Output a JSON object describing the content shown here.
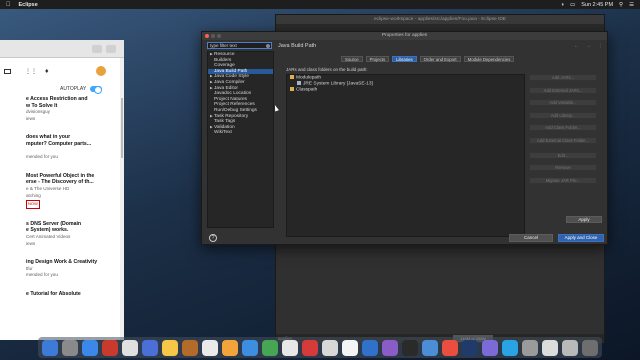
{
  "menubar": {
    "app_name": "Eclipse",
    "clock": "Sun 2:45 PM"
  },
  "browser": {
    "autoplay": "AUTOPLAY",
    "videos": [
      {
        "title": "e Access Restriction and\nw To Solve It",
        "meta": "dvisionsguy\niews"
      },
      {
        "title": "does what in your\nmputer? Computer parts...",
        "meta": "\nmended for you"
      },
      {
        "title": "Most Powerful Object in the\nerse - The Discovery of th...",
        "meta": "e & The Universe HD\natching",
        "tag": "NOW"
      },
      {
        "title": "s DNS Server (Domain\ne System) works.",
        "meta": "Cert Animated Videos\niews"
      },
      {
        "title": "ing Design Work & Creativity",
        "meta": "tfur\nmended for you"
      },
      {
        "title": "e Tutorial for Absolute",
        "meta": ""
      }
    ]
  },
  "eclipse": {
    "title": "eclipse-workspace - applies/src/applies/Foo.java - Eclipse IDE",
    "status": "applies",
    "heap": "140M of 258M"
  },
  "dialog": {
    "title": "Properties for applies",
    "filter_placeholder": "type filter text",
    "page_title": "Java Build Path",
    "tree": [
      {
        "label": "Resource",
        "expand": true
      },
      {
        "label": "Builders"
      },
      {
        "label": "Coverage"
      },
      {
        "label": "Java Build Path",
        "selected": true
      },
      {
        "label": "Java Code Style",
        "expand": true
      },
      {
        "label": "Java Compiler",
        "expand": true
      },
      {
        "label": "Java Editor",
        "expand": true
      },
      {
        "label": "Javadoc Location"
      },
      {
        "label": "Project Natures"
      },
      {
        "label": "Project References"
      },
      {
        "label": "Run/Debug Settings"
      },
      {
        "label": "Task Repository",
        "expand": true
      },
      {
        "label": "Task Tags"
      },
      {
        "label": "Validation",
        "expand": true
      },
      {
        "label": "WikiText"
      }
    ],
    "tabs": [
      "Source",
      "Projects",
      "Libraries",
      "Order and Export",
      "Module Dependencies"
    ],
    "active_tab": "Libraries",
    "jars_label": "JARs and class folders on the build path:",
    "libraries": [
      {
        "label": "Modulepath",
        "level": 1
      },
      {
        "label": "JRE System Library [JavaSE-13]",
        "level": 2
      },
      {
        "label": "Classpath",
        "level": 1
      }
    ],
    "side_buttons": [
      "Add JARs...",
      "Add External JARs...",
      "Add Variable...",
      "Add Library...",
      "Add Class Folder...",
      "Add External Class Folder...",
      "Edit...",
      "Remove",
      "Migrate JAR File..."
    ],
    "apply": "Apply",
    "cancel": "Cancel",
    "apply_close": "Apply and Close"
  }
}
